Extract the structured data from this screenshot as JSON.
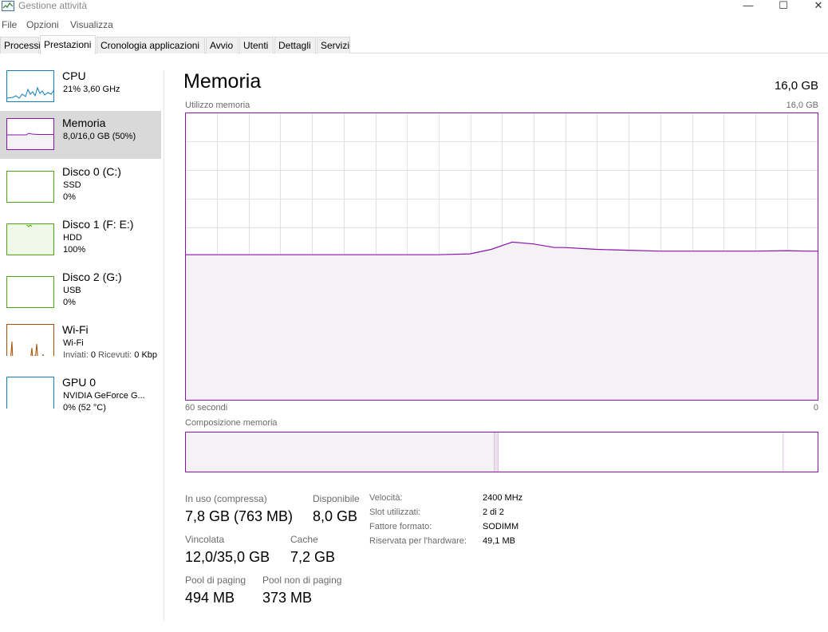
{
  "window": {
    "title": "Gestione attività",
    "minimize_glyph": "—",
    "maximize_glyph": "☐",
    "close_glyph": "✕"
  },
  "menu": [
    "File",
    "Opzioni",
    "Visualizza"
  ],
  "tabs": [
    "Processi",
    "Prestazioni",
    "Cronologia applicazioni",
    "Avvio",
    "Utenti",
    "Dettagli",
    "Servizi"
  ],
  "active_tab": "Prestazioni",
  "sidebar": {
    "items": [
      {
        "name": "CPU",
        "sub1": "21%  3,60 GHz",
        "color": "#117dbb",
        "usage_percent": 21
      },
      {
        "name": "Memoria",
        "sub1": "8,0/16,0 GB (50%)",
        "color": "#8b12ae",
        "usage_percent": 50
      },
      {
        "name": "Disco 0 (C:)",
        "sub1": "SSD",
        "sub2": "0%",
        "color": "#4da60c",
        "usage_percent": 0
      },
      {
        "name": "Disco 1 (F: E:)",
        "sub1": "HDD",
        "sub2": "100%",
        "color": "#4da60c",
        "usage_percent": 100
      },
      {
        "name": "Disco 2 (G:)",
        "sub1": "USB",
        "sub2": "0%",
        "color": "#4da60c",
        "usage_percent": 0
      },
      {
        "name": "Wi-Fi",
        "sub1": "Wi-Fi",
        "sub2_label1": "Inviati:",
        "sub2_value1": "0",
        "sub2_label2": "Ricevuti:",
        "sub2_value2": "0 Kbp",
        "color": "#a74f01"
      },
      {
        "name": "GPU 0",
        "sub1": "NVIDIA GeForce G...",
        "sub2": "0%  (52 °C)",
        "color": "#117dbb",
        "usage_percent": 0
      }
    ]
  },
  "main": {
    "title": "Memoria",
    "total": "16,0 GB",
    "graph_label": "Utilizzo memoria",
    "graph_max": "16,0 GB",
    "time_left": "60 secondi",
    "time_right": "0",
    "composition_label": "Composizione memoria",
    "colors": {
      "line": "#8b12ae",
      "fill": "#f4f2f4",
      "grid": "#e3dfe6"
    }
  },
  "chart_data": {
    "type": "area",
    "x": [
      60,
      57,
      54,
      51,
      48,
      45,
      42,
      39,
      36,
      33,
      31,
      29,
      27,
      25,
      24,
      21,
      18,
      15,
      12,
      9,
      6,
      3,
      1,
      0
    ],
    "values": [
      8.1,
      8.1,
      8.1,
      8.1,
      8.1,
      8.1,
      8.1,
      8.1,
      8.1,
      8.15,
      8.4,
      8.8,
      8.7,
      8.5,
      8.5,
      8.4,
      8.35,
      8.3,
      8.3,
      8.3,
      8.3,
      8.33,
      8.3,
      8.3
    ],
    "ylim": [
      0,
      16
    ],
    "xlim": [
      60,
      0
    ],
    "grid": true
  },
  "composition": {
    "in_use_gb": 7.8,
    "modified_gb": 0.1,
    "standby_gb": 7.2,
    "free_gb": 0.8,
    "total_gb": 16.0
  },
  "stats": {
    "in_use_label": "In uso (compressa)",
    "in_use_value": "7,8 GB (763 MB)",
    "available_label": "Disponibile",
    "available_value": "8,0 GB",
    "committed_label": "Vincolata",
    "committed_value": "12,0/35,0 GB",
    "cache_label": "Cache",
    "cache_value": "7,2 GB",
    "paged_label": "Pool di paging",
    "paged_value": "494 MB",
    "nonpaged_label": "Pool non di paging",
    "nonpaged_value": "373 MB"
  },
  "specs": [
    {
      "label": "Velocità:",
      "value": "2400 MHz"
    },
    {
      "label": "Slot utilizzati:",
      "value": "2 di 2"
    },
    {
      "label": "Fattore formato:",
      "value": "SODIMM"
    },
    {
      "label": "Riservata per l'hardware:",
      "value": "49,1 MB"
    }
  ]
}
